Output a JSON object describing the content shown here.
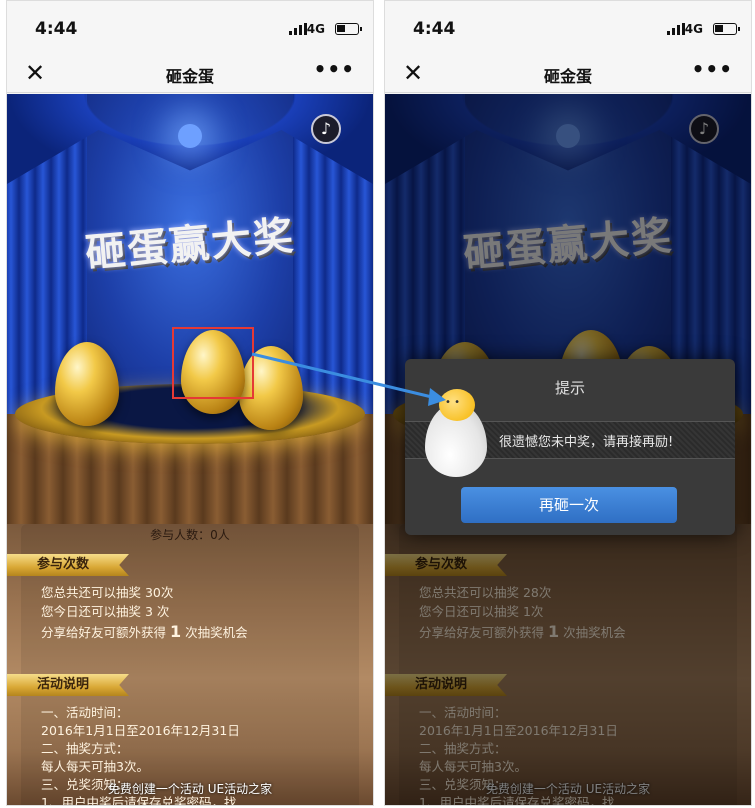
{
  "status": {
    "time": "4:44",
    "network": "4G"
  },
  "navbar": {
    "title": "砸金蛋",
    "close": "✕",
    "more": "•••"
  },
  "stage": {
    "headline": "砸蛋赢大奖"
  },
  "left": {
    "participants": "参与人数：0人",
    "section_times": "参与次数",
    "total_prefix": "您总共还可以抽奖 ",
    "total_count": "30次",
    "today_prefix": "您今日还可以抽奖 ",
    "today_count": "3 次",
    "share_prefix": "分享给好友可额外获得",
    "share_count": "1",
    "share_suffix": "次抽奖机会",
    "section_info": "活动说明",
    "rules": [
      "一、活动时间：",
      "2016年1月1日至2016年12月31日",
      "二、抽奖方式：",
      "每人每天可抽3次。",
      "三、兑奖须知：",
      "1、用户中奖后请保存兑奖密码，找..."
    ],
    "footer": "免费创建一个活动 UE活动之家"
  },
  "right": {
    "section_times": "参与次数",
    "total_prefix": "您总共还可以抽奖 ",
    "total_count": "28次",
    "today_prefix": "您今日还可以抽奖 ",
    "today_count": "1次",
    "share_prefix": "分享给好友可额外获得",
    "share_count": "1",
    "share_suffix": "次抽奖机会",
    "section_info": "活动说明",
    "rules": [
      "一、活动时间：",
      "2016年1月1日至2016年12月31日",
      "二、抽奖方式：",
      "每人每天可抽3次。",
      "三、兑奖须知：",
      "1、用户中奖后请保存兑奖密码，找..."
    ],
    "footer": "免费创建一个活动 UE活动之家"
  },
  "dialog": {
    "title": "提示",
    "message": "很遗憾您未中奖，请再接再励!",
    "retry_label": "再砸一次"
  },
  "colors": {
    "highlight": "#e53935",
    "arrow": "#3b8de0",
    "button": "#3a7fd6"
  }
}
